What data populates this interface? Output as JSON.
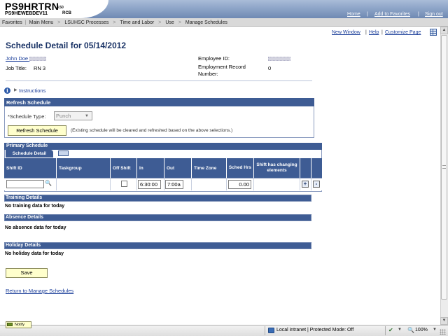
{
  "banner": {
    "system_name": "PS9HRTRN",
    "version": "8.50",
    "db_name": "PS9HEWEBDEV11",
    "user_code": "RCB",
    "links": [
      "Home",
      "Add to Favorites",
      "Sign out"
    ],
    "separator": "|"
  },
  "breadcrumb": {
    "items": [
      "Favorites",
      "Main Menu",
      "LSUHSC Processes",
      "Time and Labor",
      "Use",
      "Manage Schedules"
    ],
    "first_separator": "|",
    "chevron": ">"
  },
  "page_links": {
    "new_window": "New Window",
    "help": "Help",
    "customize_page": "Customize Page",
    "separator": "|"
  },
  "header": {
    "title": "Schedule Detail for 05/14/2012",
    "employee_name": "John Doe",
    "job_title_label": "Job Title:",
    "job_title_value": "RN 3",
    "employee_id_label": "Employee ID:",
    "employment_record_label": "Employment Record Number:",
    "employment_record_value": "0"
  },
  "instructions": {
    "label": "Instructions",
    "info_icon": "i"
  },
  "refresh_schedule": {
    "title": "Refresh Schedule",
    "schedule_type_label": "*Schedule Type:",
    "schedule_type_value": "Punch",
    "button_label": "Refresh Schedule",
    "note": "(Existing schedule will be cleared and refreshed based on the above selections.)"
  },
  "primary_schedule": {
    "title": "Primary Schedule",
    "tab_label": "Schedule Detail",
    "columns": [
      "Shift ID",
      "Taskgroup",
      "Off Shift",
      "In",
      "Out",
      "Time Zone",
      "Sched Hrs",
      "Shift has changing elements"
    ],
    "row": {
      "shift_id": "",
      "taskgroup": "",
      "off_shift": false,
      "in": "6:30:00",
      "out": "7:00a",
      "time_zone": "",
      "sched_hrs": "0.00"
    },
    "add_row": "+",
    "delete_row": "-"
  },
  "sections": {
    "training": {
      "title": "Training Details",
      "message": "No training data for today"
    },
    "absence": {
      "title": "Absence Details",
      "message": "No absence data for today"
    },
    "holiday": {
      "title": "Holiday Details",
      "message": "No holiday data for today"
    }
  },
  "save_label": "Save",
  "return_link": "Return to Manage Schedules",
  "notify_label": "Notify",
  "statusbar": {
    "zone_text": "Local intranet | Protected Mode: Off",
    "zoom": "100%"
  },
  "scrollbar": {
    "up_arrow": "▲",
    "down_arrow": "▼"
  },
  "colors": {
    "header_blue": "#3e5c94",
    "link_blue": "#1a3d99",
    "button_yellow": "#ffffcc",
    "title_blue": "#1a3366"
  }
}
